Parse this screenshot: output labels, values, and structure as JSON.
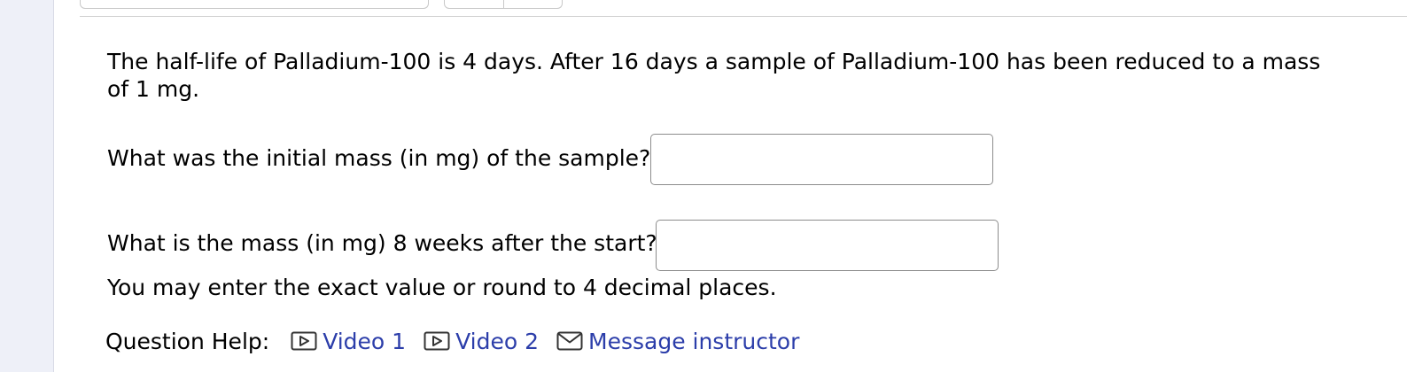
{
  "problem": {
    "text": "The half-life of Palladium-100 is 4 days. After 16 days a sample of Palladium-100 has been reduced to a mass of 1 mg."
  },
  "questions": [
    {
      "label": "What was the initial mass (in mg) of the sample?",
      "value": ""
    },
    {
      "label": "What is the mass (in mg) 8 weeks after the start?",
      "value": ""
    }
  ],
  "instruction": "You may enter the exact value or round to 4 decimal places.",
  "help": {
    "label": "Question Help:",
    "links": [
      {
        "label": "Video 1",
        "icon": "video-play-icon"
      },
      {
        "label": "Video 2",
        "icon": "video-play-icon"
      },
      {
        "label": "Message instructor",
        "icon": "envelope-icon"
      }
    ]
  },
  "colors": {
    "link": "#2c3eaa",
    "rail": "#eef0f8"
  }
}
